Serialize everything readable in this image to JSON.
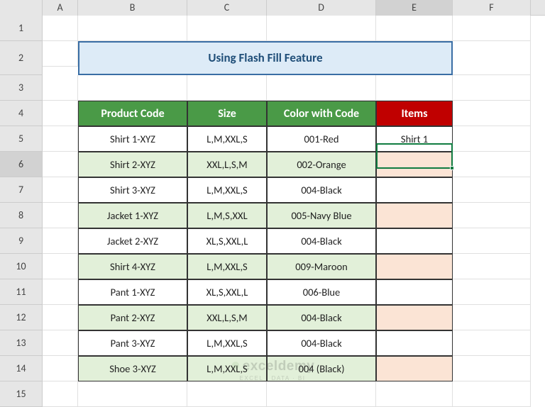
{
  "columns": [
    "A",
    "B",
    "C",
    "D",
    "E",
    "F"
  ],
  "col_widths": [
    "cA",
    "cB",
    "cC",
    "cD",
    "cE",
    "cF"
  ],
  "rows": [
    "1",
    "2",
    "3",
    "4",
    "5",
    "6",
    "7",
    "8",
    "9",
    "10",
    "11",
    "12",
    "13",
    "14",
    "15"
  ],
  "selected_col": "E",
  "selected_row": "6",
  "title": "Using Flash Fill Feature",
  "headers": {
    "b": "Product Code",
    "c": "Size",
    "d": "Color with Code",
    "e": "Items"
  },
  "data_rows": [
    {
      "b": "Shirt 1-XYZ",
      "c": "L,M,XXL,S",
      "d": "001-Red",
      "e": "Shirt 1",
      "alt": false
    },
    {
      "b": "Shirt 2-XYZ",
      "c": "XXL,L,S,M",
      "d": "002-Orange",
      "e": "",
      "alt": true
    },
    {
      "b": "Shirt 3-XYZ",
      "c": "L,M,XXL,S",
      "d": "004-Black",
      "e": "",
      "alt": false
    },
    {
      "b": "Jacket 1-XYZ",
      "c": "L,M,S,XXL",
      "d": "005-Navy Blue",
      "e": "",
      "alt": true
    },
    {
      "b": "Jacket 2-XYZ",
      "c": "XL,S,XXL,L",
      "d": "004-Black",
      "e": "",
      "alt": false
    },
    {
      "b": "Shirt 4-XYZ",
      "c": "L,M,XXL,S",
      "d": "009-Maroon",
      "e": "",
      "alt": true
    },
    {
      "b": "Pant 1-XYZ",
      "c": "XL,S,XXL,L",
      "d": "006-Blue",
      "e": "",
      "alt": false
    },
    {
      "b": "Pant 2-XYZ",
      "c": "XXL,L,S,M",
      "d": "004-Black",
      "e": "",
      "alt": true
    },
    {
      "b": "Pant 3-XYZ",
      "c": "L,M,XXL,S",
      "d": "004-Black",
      "e": "",
      "alt": false
    },
    {
      "b": "Shoe 3-XYZ",
      "c": "L,M,XXL,S",
      "d": "004 (Black)",
      "e": "",
      "alt": true
    }
  ],
  "watermark": {
    "big": "exceldemy",
    "small": "EXCEL · DATA · BI"
  }
}
